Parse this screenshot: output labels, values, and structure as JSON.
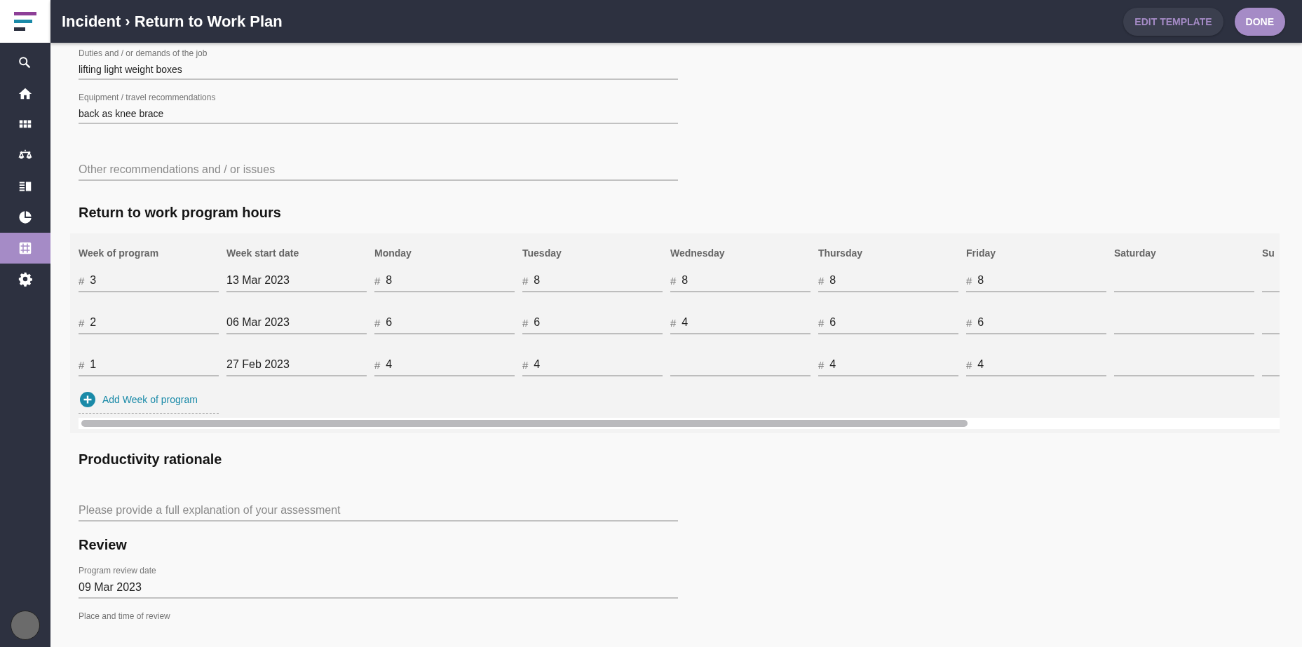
{
  "header": {
    "breadcrumb": [
      "Incident",
      "Return to Work Plan"
    ],
    "separator": "›",
    "buttons": [
      {
        "label": "EDIT TEMPLATE",
        "kind": "secondary"
      },
      {
        "label": "DONE",
        "kind": "primary"
      }
    ]
  },
  "sidebar": {
    "items": [
      {
        "selected": false
      },
      {
        "selected": false
      },
      {
        "selected": false
      },
      {
        "selected": false
      },
      {
        "selected": false
      },
      {
        "selected": false
      },
      {
        "selected": true
      },
      {
        "selected": false
      }
    ]
  },
  "fields_top": [
    {
      "label": "Duties and / or demands of the job",
      "value": "lifting light weight boxes"
    },
    {
      "label": "Equipment / travel recommendations",
      "value": "back as knee brace"
    },
    {
      "placeholder": "Other recommendations and / or issues"
    }
  ],
  "hours": {
    "title": "Return to work program hours",
    "columns": [
      "Week of program",
      "Week start date",
      "Monday",
      "Tuesday",
      "Wednesday",
      "Thursday",
      "Friday",
      "Saturday",
      "Su"
    ],
    "rows": [
      [
        {
          "prefix": "#",
          "value": "3"
        },
        {
          "value": "13 Mar 2023"
        },
        {
          "prefix": "#",
          "value": "8"
        },
        {
          "prefix": "#",
          "value": "8"
        },
        {
          "prefix": "#",
          "value": "8"
        },
        {
          "prefix": "#",
          "value": "8"
        },
        {
          "prefix": "#",
          "value": "8"
        },
        {},
        {}
      ],
      [
        {
          "prefix": "#",
          "value": "2"
        },
        {
          "value": "06 Mar 2023"
        },
        {
          "prefix": "#",
          "value": "6"
        },
        {
          "prefix": "#",
          "value": "6"
        },
        {
          "prefix": "#",
          "value": "4"
        },
        {
          "prefix": "#",
          "value": "6"
        },
        {
          "prefix": "#",
          "value": "6"
        },
        {},
        {}
      ],
      [
        {
          "prefix": "#",
          "value": "1"
        },
        {
          "value": "27 Feb 2023"
        },
        {
          "prefix": "#",
          "value": "4"
        },
        {
          "prefix": "#",
          "value": "4"
        },
        {},
        {
          "prefix": "#",
          "value": "4"
        },
        {
          "prefix": "#",
          "value": "4"
        },
        {},
        {}
      ]
    ],
    "add_label": "Add Week of program"
  },
  "productivity": {
    "title": "Productivity rationale",
    "placeholder": "Please provide a full explanation of your assessment"
  },
  "review": {
    "title": "Review",
    "fields": [
      {
        "label": "Program review date",
        "value": "09 Mar 2023"
      }
    ],
    "next_label": "Place and time of review"
  }
}
